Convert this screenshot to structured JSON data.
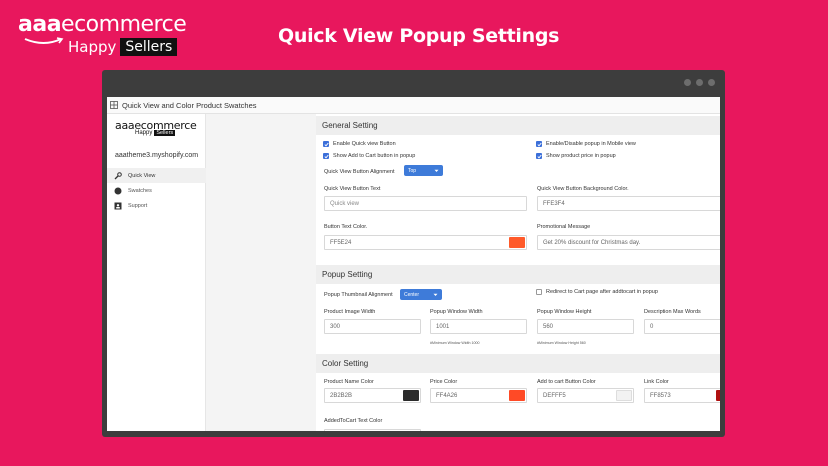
{
  "brand": {
    "line1_bold": "aaa",
    "line1_light": "ecommerce",
    "happy": "Happy",
    "sellers": "Sellers"
  },
  "page_title": "Quick View Popup Settings",
  "window": {
    "app_title": "Quick View and Color Product Swatches"
  },
  "sidebar": {
    "logo": {
      "line1": "aaaecommerce",
      "happy": "Happy",
      "sellers": "Sellers"
    },
    "store": "aaatheme3.myshopify.com",
    "items": [
      {
        "label": "Quick View",
        "icon": "wrench-icon"
      },
      {
        "label": "Swatches",
        "icon": "circle-icon"
      },
      {
        "label": "Support",
        "icon": "contact-card-icon"
      }
    ]
  },
  "general": {
    "title": "General Setting",
    "enable_quick_view": "Enable Quick view Button",
    "enable_mobile": "Enable/Disable popup in Mobile view",
    "show_add_to_cart": "Show Add to Cart button in popup",
    "show_price": "Show product price in popup",
    "alignment_label": "Quick View Button Alignment",
    "alignment_value": "Top",
    "button_text_label": "Quick View Button Text",
    "button_text_placeholder": "Quick view",
    "bg_color_label": "Quick View Button Background Color.",
    "bg_color_value": "FFE3F4",
    "text_color_label": "Button Text Color.",
    "text_color_value": "FF5E24",
    "promo_label": "Promotional Message",
    "promo_value": "Get 20% discount for Christmas day."
  },
  "popup": {
    "title": "Popup Setting",
    "thumb_align_label": "Popup Thumbnail Alignment",
    "thumb_align_value": "Center",
    "redirect_label": "Redirect to Cart page after addtocart in popup",
    "image_width_label": "Product Image Width",
    "image_width_value": "300",
    "window_width_label": "Popup Window Width",
    "window_width_value": "1001",
    "window_width_hint": "#Minimum Window Width 1000",
    "window_height_label": "Popup Window Height",
    "window_height_value": "560",
    "window_height_hint": "#Minimum Window Height 560",
    "max_words_label": "Description Max Words",
    "max_words_value": "0"
  },
  "color": {
    "title": "Color Setting",
    "name_color_label": "Product Name Color",
    "name_color_value": "2B2B2B",
    "price_color_label": "Price Color",
    "price_color_value": "FF4A26",
    "cart_color_label": "Add to cart Button Color",
    "cart_color_value": "DEFFF5",
    "link_color_label": "Link Color",
    "link_color_value": "FF8573",
    "added_text_label": "AddedToCart Text Color"
  },
  "colors": {
    "background": "#e8175d",
    "accent_blue": "#3e7bd9",
    "swatch_orange": "#ff5a2a",
    "swatch_dark": "#2b2b2b",
    "swatch_light": "#f2f2f2"
  }
}
